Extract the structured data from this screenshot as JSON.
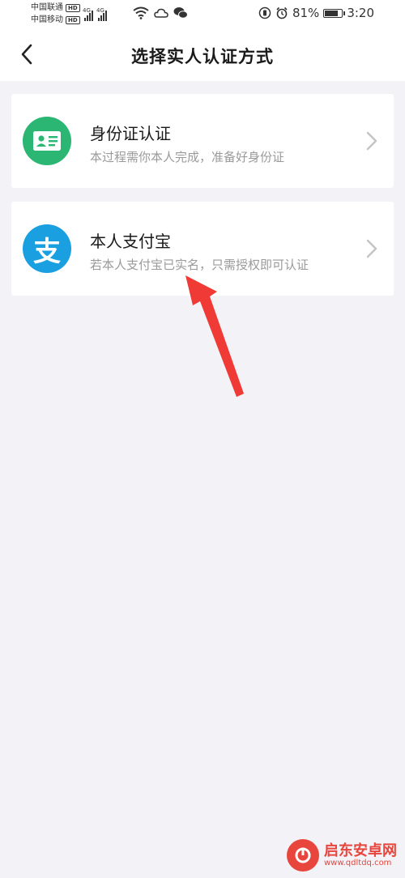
{
  "statusbar": {
    "carrier1": "中国联通",
    "carrier2": "中国移动",
    "hd_badge": "HD",
    "network1": "4G",
    "network2": "4G",
    "battery": "81%",
    "battery_level": 0.81,
    "time": "3:20"
  },
  "navbar": {
    "title": "选择实人认证方式"
  },
  "options": [
    {
      "title": "身份证认证",
      "desc": "本过程需你本人完成，准备好身份证",
      "icon_color": "#2bb673"
    },
    {
      "title": "本人支付宝",
      "desc": "若本人支付宝已实名，只需授权即可认证",
      "icon_color": "#1a9fe0",
      "icon_glyph": "支"
    }
  ],
  "colors": {
    "background": "#f2f2f7",
    "annotation_arrow": "#f03a35"
  },
  "watermark": {
    "title": "启东安卓网",
    "url": "www.qdltdq.com"
  }
}
